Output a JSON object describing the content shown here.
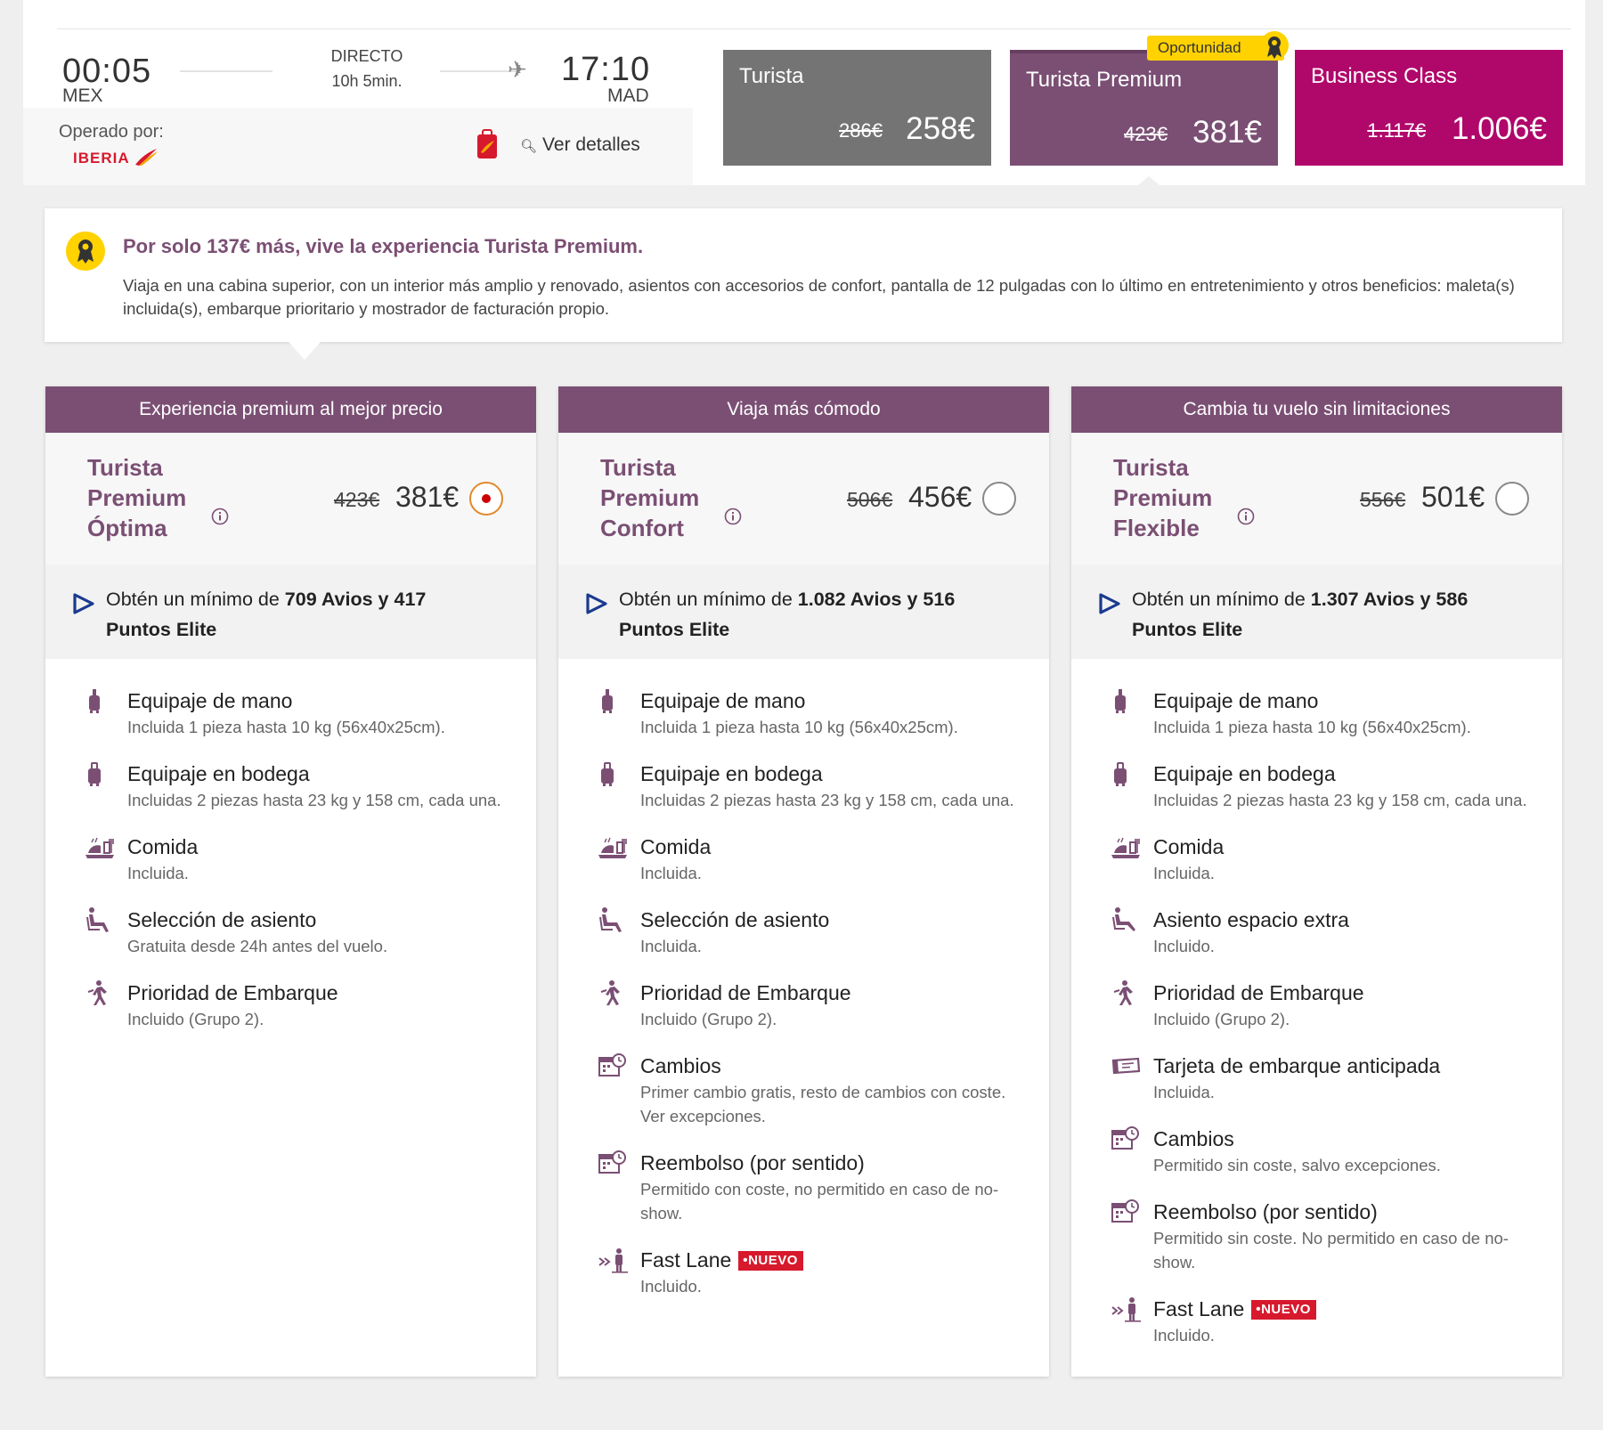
{
  "flight": {
    "dep_time": "00:05",
    "dep_code": "MEX",
    "arr_time": "17:10",
    "arr_code": "MAD",
    "type": "DIRECTO",
    "duration": "10h 5min.",
    "operated_by_label": "Operado por:",
    "airline": "IBERIA",
    "details_label": "Ver detalles"
  },
  "fare_classes": [
    {
      "label": "Turista",
      "old_price": "286€",
      "price": "258€",
      "color": "#747474"
    },
    {
      "label": "Turista Premium",
      "old_price": "423€",
      "price": "381€",
      "color": "#7b4f74",
      "badge": "Oportunidad"
    },
    {
      "label": "Business Class",
      "old_price": "1.117€",
      "price": "1.006€",
      "color": "#b0076b"
    }
  ],
  "banner": {
    "title": "Por solo 137€ más, vive la experiencia Turista Premium.",
    "description": "Viaja en una cabina superior, con un interior más amplio y renovado, asientos con accesorios de confort, pantalla de 12 pulgadas con lo último en entretenimiento y otros beneficios: maleta(s) incluida(s), embarque prioritario y mostrador de facturación propio."
  },
  "cards": [
    {
      "header": "Experiencia premium al mejor precio",
      "name_lines": [
        "Turista",
        "Premium",
        "Óptima"
      ],
      "old_price": "423€",
      "price": "381€",
      "selected": true,
      "avios_prefix": "Obtén un mínimo de ",
      "avios_bold1": "709 Avios y 417",
      "avios_bold2": "Puntos Elite",
      "features": [
        {
          "icon": "hand-luggage-icon",
          "title": "Equipaje de mano",
          "desc": "Incluida 1 pieza hasta 10 kg (56x40x25cm)."
        },
        {
          "icon": "checked-bag-icon",
          "title": "Equipaje en bodega",
          "desc": "Incluidas 2 piezas hasta 23 kg y 158 cm, cada una."
        },
        {
          "icon": "meal-icon",
          "title": "Comida",
          "desc": "Incluida."
        },
        {
          "icon": "seat-icon",
          "title": "Selección de asiento",
          "desc": "Gratuita desde 24h antes del vuelo."
        },
        {
          "icon": "priority-boarding-icon",
          "title": "Prioridad de Embarque",
          "desc": "Incluido (Grupo 2)."
        }
      ]
    },
    {
      "header": "Viaja más cómodo",
      "name_lines": [
        "Turista",
        "Premium",
        "Confort"
      ],
      "old_price": "506€",
      "price": "456€",
      "selected": false,
      "avios_prefix": "Obtén un mínimo de ",
      "avios_bold1": "1.082 Avios y 516",
      "avios_bold2": "Puntos Elite",
      "features": [
        {
          "icon": "hand-luggage-icon",
          "title": "Equipaje de mano",
          "desc": "Incluida 1 pieza hasta 10 kg (56x40x25cm)."
        },
        {
          "icon": "checked-bag-icon",
          "title": "Equipaje en bodega",
          "desc": "Incluidas 2 piezas hasta 23 kg y 158 cm, cada una."
        },
        {
          "icon": "meal-icon",
          "title": "Comida",
          "desc": "Incluida."
        },
        {
          "icon": "seat-icon",
          "title": "Selección de asiento",
          "desc": "Incluida."
        },
        {
          "icon": "priority-boarding-icon",
          "title": "Prioridad de Embarque",
          "desc": "Incluido (Grupo 2)."
        },
        {
          "icon": "calendar-change-icon",
          "title": "Cambios",
          "desc": "Primer cambio gratis, resto de cambios con coste. Ver excepciones."
        },
        {
          "icon": "calendar-refund-icon",
          "title": "Reembolso (por sentido)",
          "desc": "Permitido con coste, no permitido en caso de no-show."
        },
        {
          "icon": "fast-lane-icon",
          "title": "Fast Lane",
          "badge": "NUEVO",
          "desc": "Incluido."
        }
      ]
    },
    {
      "header": "Cambia tu vuelo sin limitaciones",
      "name_lines": [
        "Turista",
        "Premium",
        "Flexible"
      ],
      "old_price": "556€",
      "price": "501€",
      "selected": false,
      "avios_prefix": "Obtén un mínimo de ",
      "avios_bold1": "1.307 Avios y 586",
      "avios_bold2": "Puntos Elite",
      "features": [
        {
          "icon": "hand-luggage-icon",
          "title": "Equipaje de mano",
          "desc": "Incluida 1 pieza hasta 10 kg (56x40x25cm)."
        },
        {
          "icon": "checked-bag-icon",
          "title": "Equipaje en bodega",
          "desc": "Incluidas 2 piezas hasta 23 kg y 158 cm, cada una."
        },
        {
          "icon": "meal-icon",
          "title": "Comida",
          "desc": "Incluida."
        },
        {
          "icon": "extra-space-seat-icon",
          "title": "Asiento espacio extra",
          "desc": "Incluido."
        },
        {
          "icon": "priority-boarding-icon",
          "title": "Prioridad de Embarque",
          "desc": "Incluido (Grupo 2)."
        },
        {
          "icon": "boarding-pass-icon",
          "title": "Tarjeta de embarque anticipada",
          "desc": "Incluida."
        },
        {
          "icon": "calendar-change-icon",
          "title": "Cambios",
          "desc": "Permitido sin coste, salvo excepciones."
        },
        {
          "icon": "calendar-refund-icon",
          "title": "Reembolso (por sentido)",
          "desc": "Permitido sin coste. No permitido en caso de no-show."
        },
        {
          "icon": "fast-lane-icon",
          "title": "Fast Lane",
          "badge": "NUEVO",
          "desc": "Incluido."
        }
      ]
    }
  ]
}
